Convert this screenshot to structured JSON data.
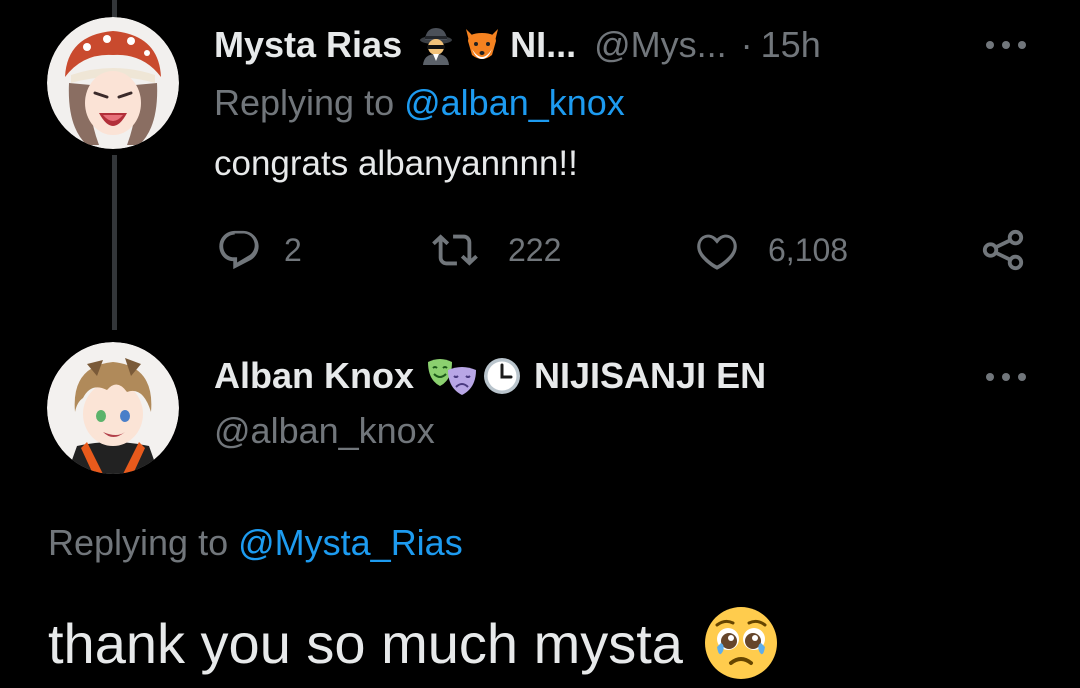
{
  "reply_tweet": {
    "display_name": "Mysta Rias",
    "affiliation_truncated": "NI...",
    "handle_truncated": "@Mys...",
    "separator": "·",
    "time": "15h",
    "replying_prefix": "Replying to",
    "replying_handle": "@alban_knox",
    "text": "congrats albanyannnn!!",
    "emojis": [
      "detective-emoji",
      "fox-emoji"
    ],
    "actions": {
      "replies": "2",
      "retweets": "222",
      "likes": "6,108"
    }
  },
  "main_tweet": {
    "display_name": "Alban Knox",
    "emojis": [
      "performing-arts-emoji",
      "clock-emoji"
    ],
    "affiliation": "NIJISANJI EN",
    "handle": "@alban_knox",
    "replying_prefix": "Replying to",
    "replying_handle": "@Mysta_Rias",
    "text": "thank you so much mysta",
    "text_emoji": "pleading-face-emoji"
  },
  "colors": {
    "background": "#000000",
    "text_primary": "#e7e9ea",
    "text_muted": "#71767b",
    "accent_link": "#1d9bf0",
    "thread_line": "#333639"
  }
}
